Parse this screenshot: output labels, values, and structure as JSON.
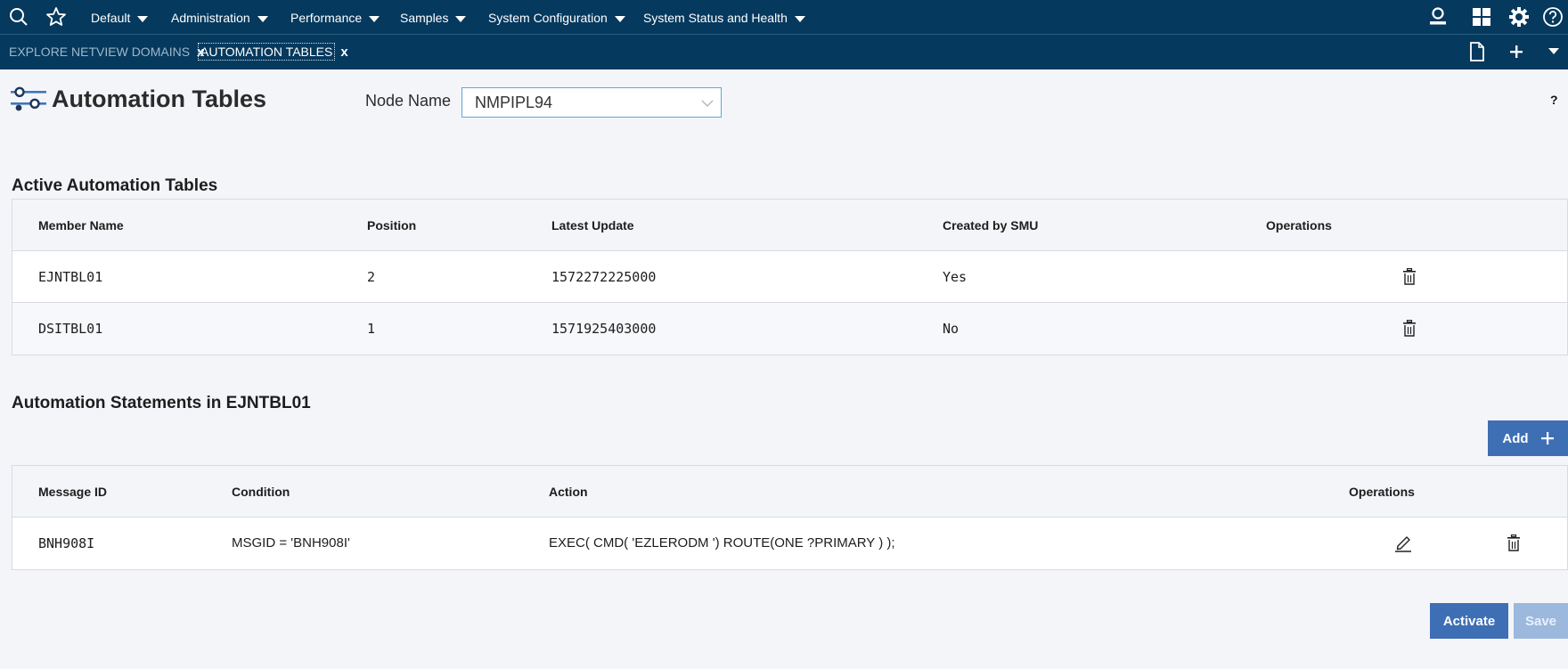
{
  "topnav": {
    "menus": [
      {
        "label": "Default"
      },
      {
        "label": "Administration"
      },
      {
        "label": "Performance"
      },
      {
        "label": "Samples"
      },
      {
        "label": "System Configuration"
      },
      {
        "label": "System Status and Health"
      }
    ],
    "icons": [
      "search-icon",
      "star-icon",
      "user-icon",
      "grid-icon",
      "settings-icon",
      "help-icon"
    ]
  },
  "tabs": [
    {
      "label": "EXPLORE NETVIEW DOMAINS",
      "close": "x",
      "active": false
    },
    {
      "label": "AUTOMATION TABLES",
      "close": "x",
      "active": true
    }
  ],
  "header": {
    "title": "Automation Tables",
    "node_label": "Node Name",
    "node_value": "NMPIPL94",
    "help": "?"
  },
  "active_tables": {
    "title": "Active Automation Tables",
    "columns": [
      "Member Name",
      "Position",
      "Latest Update",
      "Created by SMU",
      "Operations"
    ],
    "rows": [
      {
        "member": "EJNTBL01",
        "position": "2",
        "latest_update": "1572272225000",
        "smu": "Yes"
      },
      {
        "member": "DSITBL01",
        "position": "1",
        "latest_update": "1571925403000",
        "smu": "No"
      }
    ]
  },
  "statements": {
    "title": "Automation Statements in EJNTBL01",
    "add_label": "Add",
    "columns": [
      "Message ID",
      "Condition",
      "Action",
      "Operations"
    ],
    "rows": [
      {
        "message_id": "BNH908I",
        "condition": "MSGID = 'BNH908I'",
        "action": "EXEC( CMD( 'EZLERODM ') ROUTE(ONE ?PRIMARY ) );"
      }
    ]
  },
  "footer": {
    "activate_label": "Activate",
    "save_label": "Save"
  },
  "colors": {
    "nav": "#05395e",
    "primary": "#3e6fb5",
    "disabled": "#9cb8dd",
    "background": "#f3f5f9"
  }
}
